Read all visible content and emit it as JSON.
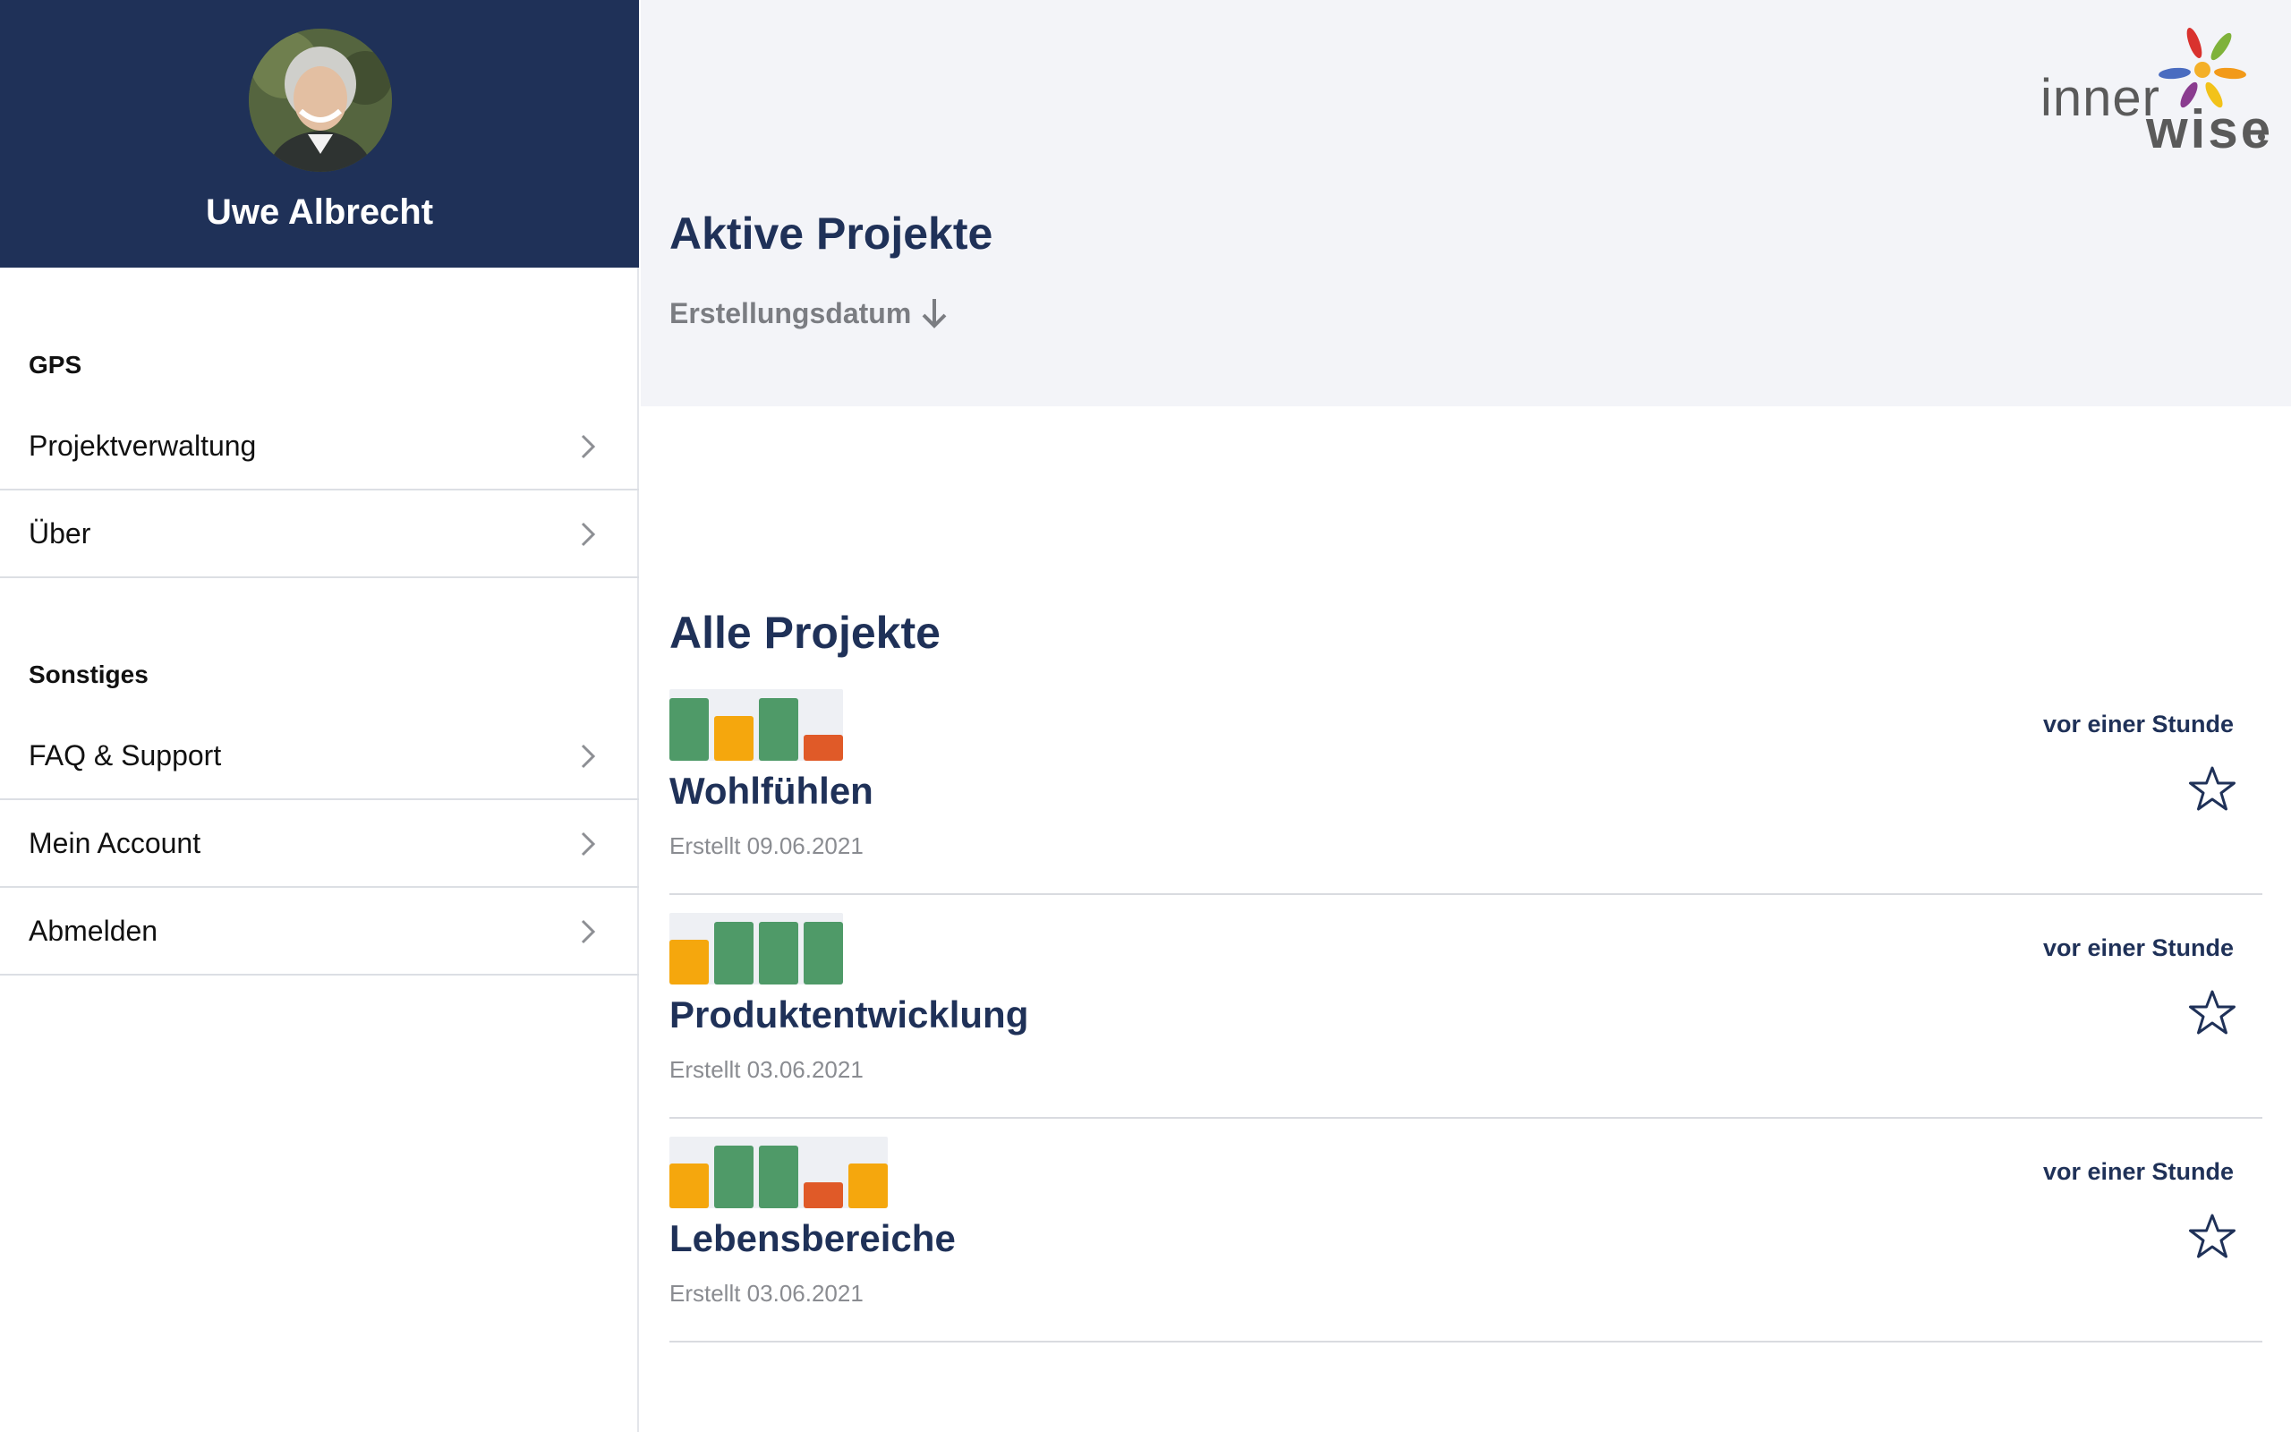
{
  "profile": {
    "name": "Uwe Albrecht"
  },
  "sidebar": {
    "sections": [
      {
        "heading": "GPS",
        "items": [
          {
            "label": "Projektverwaltung"
          },
          {
            "label": "Über"
          }
        ]
      },
      {
        "heading": "Sonstiges",
        "items": [
          {
            "label": "FAQ & Support"
          },
          {
            "label": "Mein Account"
          },
          {
            "label": "Abmelden"
          }
        ]
      }
    ]
  },
  "brand": {
    "logo_text_1": "inner",
    "logo_text_2": "wise"
  },
  "main": {
    "active_title": "Aktive Projekte",
    "sort_label": "Erstellungsdatum",
    "sort_icon": "arrow-down-icon",
    "all_title": "Alle Projekte",
    "projects": [
      {
        "title": "Wohlfühlen",
        "created": "Erstellt 09.06.2021",
        "time": "vor einer Stunde",
        "favorite": false,
        "bars": [
          {
            "level": 1.0,
            "color": "#4f9a68"
          },
          {
            "level": 0.72,
            "color": "#f5a70d"
          },
          {
            "level": 1.0,
            "color": "#4f9a68"
          },
          {
            "level": 0.42,
            "color": "#e05a28"
          }
        ]
      },
      {
        "title": "Produktentwicklung",
        "created": "Erstellt 03.06.2021",
        "time": "vor einer Stunde",
        "favorite": false,
        "bars": [
          {
            "level": 0.72,
            "color": "#f5a70d"
          },
          {
            "level": 1.0,
            "color": "#4f9a68"
          },
          {
            "level": 1.0,
            "color": "#4f9a68"
          },
          {
            "level": 1.0,
            "color": "#4f9a68"
          }
        ]
      },
      {
        "title": "Lebensbereiche",
        "created": "Erstellt 03.06.2021",
        "time": "vor einer Stunde",
        "favorite": false,
        "bars": [
          {
            "level": 0.72,
            "color": "#f5a70d"
          },
          {
            "level": 1.0,
            "color": "#4f9a68"
          },
          {
            "level": 1.0,
            "color": "#4f9a68"
          },
          {
            "level": 0.42,
            "color": "#e05a28"
          },
          {
            "level": 0.72,
            "color": "#f5a70d"
          }
        ]
      }
    ]
  },
  "colors": {
    "sidebar_header": "#1f3158",
    "accent": "#1f3158",
    "main_header_bg": "#f3f4f8",
    "green": "#4f9a68",
    "yellow": "#f5a70d",
    "red": "#e05a28"
  }
}
